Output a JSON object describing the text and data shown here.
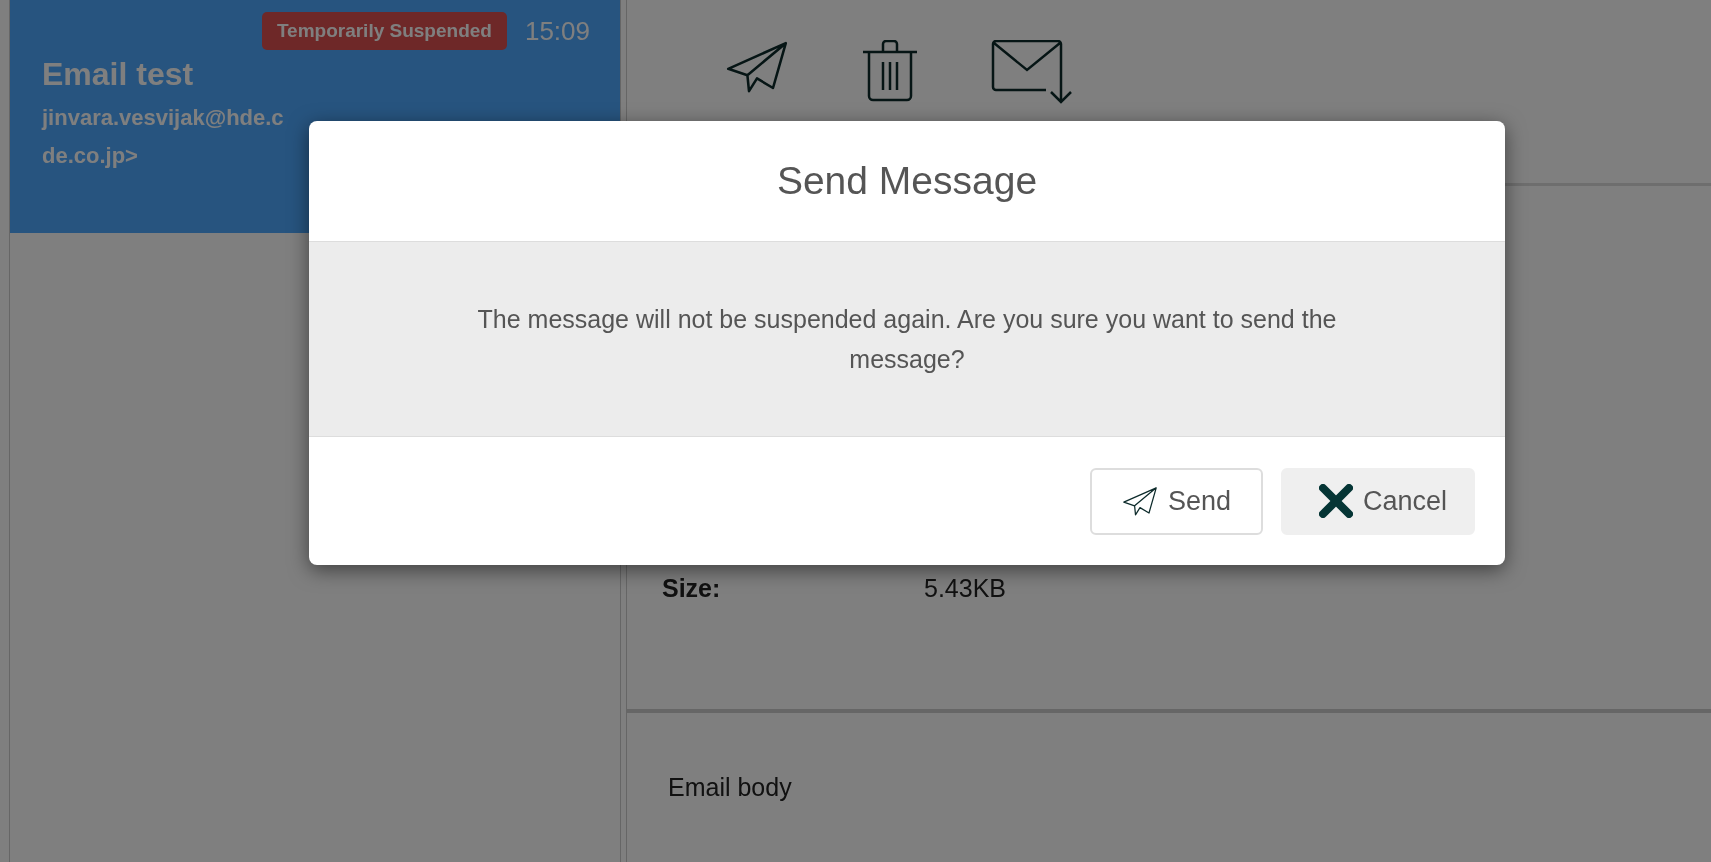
{
  "message_card": {
    "badge": "Temporarily Suspended",
    "time": "15:09",
    "subject": "Email test",
    "sender_lines": [
      "jinvara.vesvijak@hde.c",
      "de.co.jp>"
    ],
    "selected": true
  },
  "toolbar": [
    {
      "kind": "send"
    },
    {
      "kind": "discard"
    },
    {
      "kind": "download"
    }
  ],
  "details": [
    {
      "label": "Size:",
      "value": "5.43KB"
    }
  ],
  "body": "Email body",
  "dialog": {
    "title": "Send Message",
    "message": "The message will not be suspended again. Are you sure you want to send the message?",
    "buttons": [
      {
        "kind": "send",
        "label": "Send"
      },
      {
        "kind": "cancel",
        "label": "Cancel"
      }
    ]
  }
}
